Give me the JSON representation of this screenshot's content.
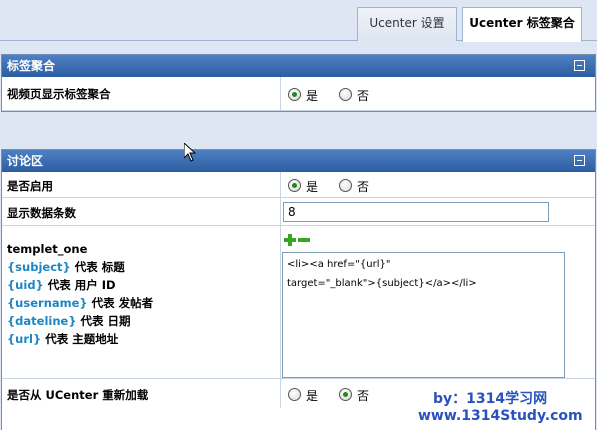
{
  "tabs": [
    {
      "label": "Ucenter 设置"
    },
    {
      "label": "Ucenter 标签聚合"
    }
  ],
  "panel_tags": {
    "title": "标签聚合",
    "row_label": "视频页显示标签聚合",
    "yes": "是",
    "no": "否"
  },
  "panel_forum": {
    "title": "讨论区",
    "enable_label": "是否启用",
    "yes": "是",
    "no": "否",
    "count_label": "显示数据条数",
    "count_value": "8",
    "template_name": "templet_one",
    "vars": [
      {
        "tag": "{subject}",
        "desc": " 代表 标题"
      },
      {
        "tag": "{uid}",
        "desc": " 代表 用户 ID"
      },
      {
        "tag": "{username}",
        "desc": " 代表 发帖者"
      },
      {
        "tag": "{dateline}",
        "desc": " 代表 日期"
      },
      {
        "tag": "{url}",
        "desc": " 代表 主题地址"
      }
    ],
    "template_code": "<li><a href=\"{url}\"\ntarget=\"_blank\">{subject}</a></li>",
    "reload_label": "是否从 UCenter 重新加载",
    "reload_yes": "是",
    "reload_no": "否"
  },
  "watermark": {
    "line1": "by：1314学习网",
    "line2": "www.1314Study.com"
  }
}
